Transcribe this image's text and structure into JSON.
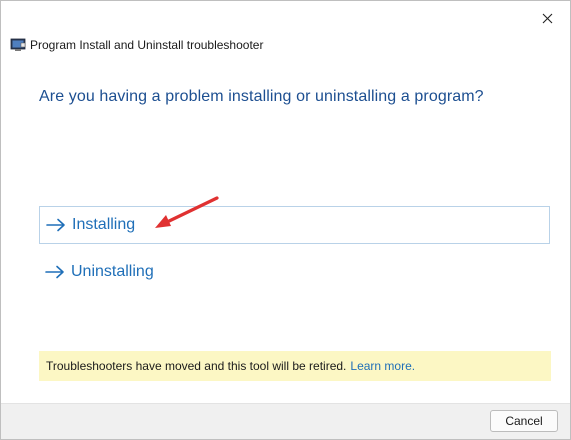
{
  "window": {
    "title": "Program Install and Uninstall troubleshooter"
  },
  "main": {
    "heading": "Are you having a problem installing or uninstalling a program?",
    "options": [
      {
        "label": "Installing",
        "icon": "arrow-right-icon",
        "selected": true
      },
      {
        "label": "Uninstalling",
        "icon": "arrow-right-icon",
        "selected": false
      }
    ]
  },
  "notice": {
    "text": "Troubleshooters have moved and this tool will be retired.",
    "link": "Learn more."
  },
  "footer": {
    "cancel_label": "Cancel"
  },
  "colors": {
    "heading": "#1d4f91",
    "link": "#1f6fb8",
    "notice_bg": "#fcf7c4",
    "annotation_arrow": "#e03131",
    "selected_border": "#b9d2e8"
  }
}
